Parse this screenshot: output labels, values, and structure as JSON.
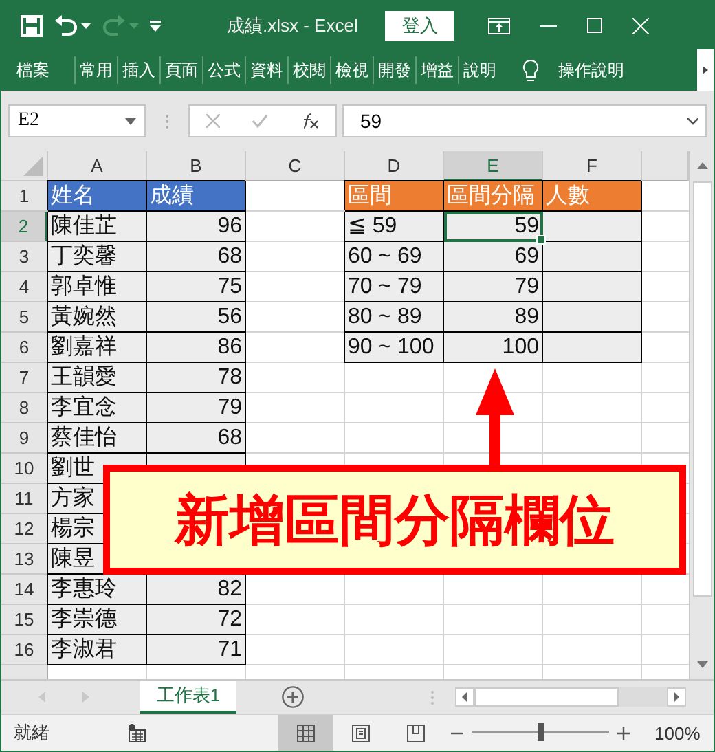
{
  "window": {
    "title": "成績.xlsx  -  Excel",
    "sign_in": "登入"
  },
  "ribbon": {
    "tabs": [
      {
        "label": "檔案"
      },
      {
        "label": "常用"
      },
      {
        "label": "插入"
      },
      {
        "label": "頁面"
      },
      {
        "label": "公式"
      },
      {
        "label": "資料"
      },
      {
        "label": "校閱"
      },
      {
        "label": "檢視"
      },
      {
        "label": "開發"
      },
      {
        "label": "增益"
      },
      {
        "label": "說明"
      }
    ],
    "tell_me": "操作說明"
  },
  "formula_bar": {
    "name_box": "E2",
    "formula": "59"
  },
  "columns": [
    {
      "label": "A",
      "selected": false
    },
    {
      "label": "B",
      "selected": false
    },
    {
      "label": "C",
      "selected": false
    },
    {
      "label": "D",
      "selected": false
    },
    {
      "label": "E",
      "selected": true
    },
    {
      "label": "F",
      "selected": false
    }
  ],
  "rows": [
    {
      "number": "1",
      "selected": false,
      "cells": [
        {
          "kind": "head_blue",
          "text": "姓名"
        },
        {
          "kind": "head_blue",
          "text": "成績"
        },
        {
          "kind": "blank"
        },
        {
          "kind": "head_orange",
          "text": "區間"
        },
        {
          "kind": "head_orange",
          "text": "區間分隔"
        },
        {
          "kind": "head_orange",
          "text": "人數"
        }
      ]
    },
    {
      "number": "2",
      "selected": true,
      "cells": [
        {
          "kind": "text",
          "text": "陳佳芷"
        },
        {
          "kind": "number",
          "text": "96"
        },
        {
          "kind": "blank"
        },
        {
          "kind": "text",
          "text": "≦ 59"
        },
        {
          "kind": "number",
          "text": "59"
        },
        {
          "kind": "text"
        }
      ]
    },
    {
      "number": "3",
      "selected": false,
      "cells": [
        {
          "kind": "text",
          "text": "丁奕馨"
        },
        {
          "kind": "number",
          "text": "68"
        },
        {
          "kind": "blank"
        },
        {
          "kind": "text",
          "text": "60 ~ 69"
        },
        {
          "kind": "number",
          "text": "69"
        },
        {
          "kind": "text"
        }
      ]
    },
    {
      "number": "4",
      "selected": false,
      "cells": [
        {
          "kind": "text",
          "text": "郭卓惟"
        },
        {
          "kind": "number",
          "text": "75"
        },
        {
          "kind": "blank"
        },
        {
          "kind": "text",
          "text": "70 ~ 79"
        },
        {
          "kind": "number",
          "text": "79"
        },
        {
          "kind": "text"
        }
      ]
    },
    {
      "number": "5",
      "selected": false,
      "cells": [
        {
          "kind": "text",
          "text": "黃婉然"
        },
        {
          "kind": "number",
          "text": "56"
        },
        {
          "kind": "blank"
        },
        {
          "kind": "text",
          "text": "80 ~ 89"
        },
        {
          "kind": "number",
          "text": "89"
        },
        {
          "kind": "text"
        }
      ]
    },
    {
      "number": "6",
      "selected": false,
      "cells": [
        {
          "kind": "text",
          "text": "劉嘉祥"
        },
        {
          "kind": "number",
          "text": "86"
        },
        {
          "kind": "blank"
        },
        {
          "kind": "text",
          "text": "90 ~ 100"
        },
        {
          "kind": "number",
          "text": "100"
        },
        {
          "kind": "text"
        }
      ]
    },
    {
      "number": "7",
      "selected": false,
      "cells": [
        {
          "kind": "text",
          "text": "王韻愛"
        },
        {
          "kind": "number",
          "text": "78"
        }
      ]
    },
    {
      "number": "8",
      "selected": false,
      "cells": [
        {
          "kind": "text",
          "text": "李宜念"
        },
        {
          "kind": "number",
          "text": "79"
        }
      ]
    },
    {
      "number": "9",
      "selected": false,
      "cells": [
        {
          "kind": "text",
          "text": "蔡佳怡"
        },
        {
          "kind": "number",
          "text": "68"
        }
      ]
    },
    {
      "number": "10",
      "selected": false,
      "cells": [
        {
          "kind": "text",
          "text": "劉世"
        },
        {
          "kind": "number"
        }
      ]
    },
    {
      "number": "11",
      "selected": false,
      "cells": [
        {
          "kind": "text",
          "text": "方家"
        }
      ]
    },
    {
      "number": "12",
      "selected": false,
      "cells": [
        {
          "kind": "text",
          "text": "楊宗"
        }
      ]
    },
    {
      "number": "13",
      "selected": false,
      "cells": [
        {
          "kind": "text",
          "text": "陳昱"
        }
      ]
    },
    {
      "number": "14",
      "selected": false,
      "cells": [
        {
          "kind": "text",
          "text": "李惠玲"
        },
        {
          "kind": "number",
          "text": "82"
        }
      ]
    },
    {
      "number": "15",
      "selected": false,
      "cells": [
        {
          "kind": "text",
          "text": "李崇德"
        },
        {
          "kind": "number",
          "text": "72"
        }
      ]
    },
    {
      "number": "16",
      "selected": false,
      "cells": [
        {
          "kind": "text",
          "text": "李淑君"
        },
        {
          "kind": "number",
          "text": "71"
        }
      ]
    }
  ],
  "callout": {
    "text": "新增區間分隔欄位"
  },
  "sheet_tabs": [
    {
      "label": "工作表1",
      "selected": true
    }
  ],
  "status_bar": {
    "status": "就緒",
    "zoom": "100%",
    "zoom_slider": {
      "level": 0.5
    }
  }
}
